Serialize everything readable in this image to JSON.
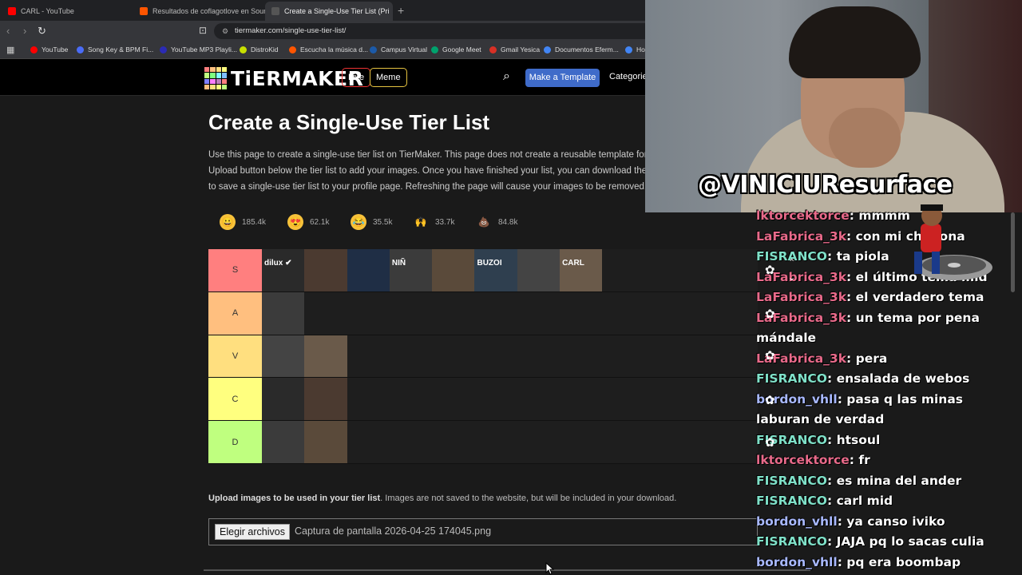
{
  "browser": {
    "tabs": [
      {
        "title": "CARL - YouTube",
        "favicon_color": "#ff0000"
      },
      {
        "title": "Resultados de coflagotlove en Sound",
        "favicon_color": "#ff5500"
      },
      {
        "title": "Create a Single-Use Tier List (Pri",
        "favicon_color": "#333333",
        "active": true
      }
    ],
    "new_tab": "+",
    "close": "✕",
    "url": "tiermaker.com/single-use-tier-list/",
    "bookmarks": [
      {
        "label": "YouTube",
        "color": "#ff0000"
      },
      {
        "label": "Song Key & BPM Fi...",
        "color": "#4a6cf7"
      },
      {
        "label": "YouTube MP3 Playli...",
        "color": "#2b2bb5"
      },
      {
        "label": "DistroKid",
        "color": "#c8e000"
      },
      {
        "label": "Escucha la música d...",
        "color": "#ff5500"
      },
      {
        "label": "Campus Virtual",
        "color": "#1c5aa8"
      },
      {
        "label": "Google Meet",
        "color": "#00a26d"
      },
      {
        "label": "Gmail Yesica",
        "color": "#d93025"
      },
      {
        "label": "Documentos Eferm...",
        "color": "#4285f4"
      },
      {
        "label": "Ho",
        "color": "#4285f4"
      }
    ]
  },
  "site": {
    "logo": "TiERMAKER",
    "live": "Live",
    "meme": "Meme",
    "make_template": "Make a Template",
    "categories": "Categorie",
    "title": "Create a Single-Use Tier List",
    "intro_lines": [
      "Use this page to create a single-use tier list on TierMaker. This page does not create a reusable template for o",
      "Upload button below the tier list to add your images. Once you have finished your list, you can download the f",
      "to save a single-use tier list to your profile page. Refreshing the page will cause your images to be removed."
    ],
    "reactions": [
      {
        "emoji": "😀",
        "count": "185.4k"
      },
      {
        "emoji": "😍",
        "count": "62.1k"
      },
      {
        "emoji": "😂",
        "count": "35.5k"
      },
      {
        "emoji": "🙌",
        "count": "33.7k"
      },
      {
        "emoji": "💩",
        "count": "84.8k"
      }
    ],
    "tiers": [
      {
        "label": "S",
        "color": "#ff7f7f",
        "items": 8
      },
      {
        "label": "A",
        "color": "#ffbf7f",
        "items": 1
      },
      {
        "label": "V",
        "color": "#ffdf7f",
        "items": 2
      },
      {
        "label": "C",
        "color": "#ffff7f",
        "items": 2
      },
      {
        "label": "D",
        "color": "#bfff7f",
        "items": 2
      }
    ],
    "thumb_texts": [
      "dilux ✔",
      "",
      "",
      "NIÑ",
      "",
      "BUZOI",
      "",
      "CARL"
    ],
    "upload_bold": "Upload images to be used in your tier list",
    "upload_rest": ". Images are not saved to the website, but will be included in your download.",
    "file_button": "Elegir archivos",
    "file_name": "Captura de pantalla 2026-04-25 174045.png"
  },
  "stream": {
    "overlay_name": "@VINICIUResurface",
    "chat": [
      {
        "user": "lktorcektorce",
        "color": "#e86a8a",
        "msg": "mmmm"
      },
      {
        "user": "LaFabrica_3k",
        "color": "#e86a8a",
        "msg": "con mi chabona"
      },
      {
        "user": "FISRANCO",
        "color": "#7fe0c8",
        "msg": "ta piola"
      },
      {
        "user": "LaFabrica_3k",
        "color": "#e86a8a",
        "msg": "el último tema mld"
      },
      {
        "user": "LaFabrica_3k",
        "color": "#e86a8a",
        "msg": "el verdadero tema"
      },
      {
        "user": "LaFabrica_3k",
        "color": "#e86a8a",
        "msg": "un tema por pena mándale"
      },
      {
        "user": "LaFabrica_3k",
        "color": "#e86a8a",
        "msg": "pera"
      },
      {
        "user": "FISRANCO",
        "color": "#7fe0c8",
        "msg": "ensalada de webos"
      },
      {
        "user": "bordon_vhll",
        "color": "#a8b8ff",
        "msg": "pasa q las minas laburan de verdad"
      },
      {
        "user": "FISRANCO",
        "color": "#7fe0c8",
        "msg": "htsoul"
      },
      {
        "user": "lktorcektorce",
        "color": "#e86a8a",
        "msg": "fr"
      },
      {
        "user": "FISRANCO",
        "color": "#7fe0c8",
        "msg": "es mina del ander"
      },
      {
        "user": "FISRANCO",
        "color": "#7fe0c8",
        "msg": "carl mid"
      },
      {
        "user": "bordon_vhll",
        "color": "#a8b8ff",
        "msg": "ya canso iviko"
      },
      {
        "user": "FISRANCO",
        "color": "#7fe0c8",
        "msg": "JAJA pq lo sacas culia"
      },
      {
        "user": "bordon_vhll",
        "color": "#a8b8ff",
        "msg": "pq era boombap"
      }
    ]
  }
}
